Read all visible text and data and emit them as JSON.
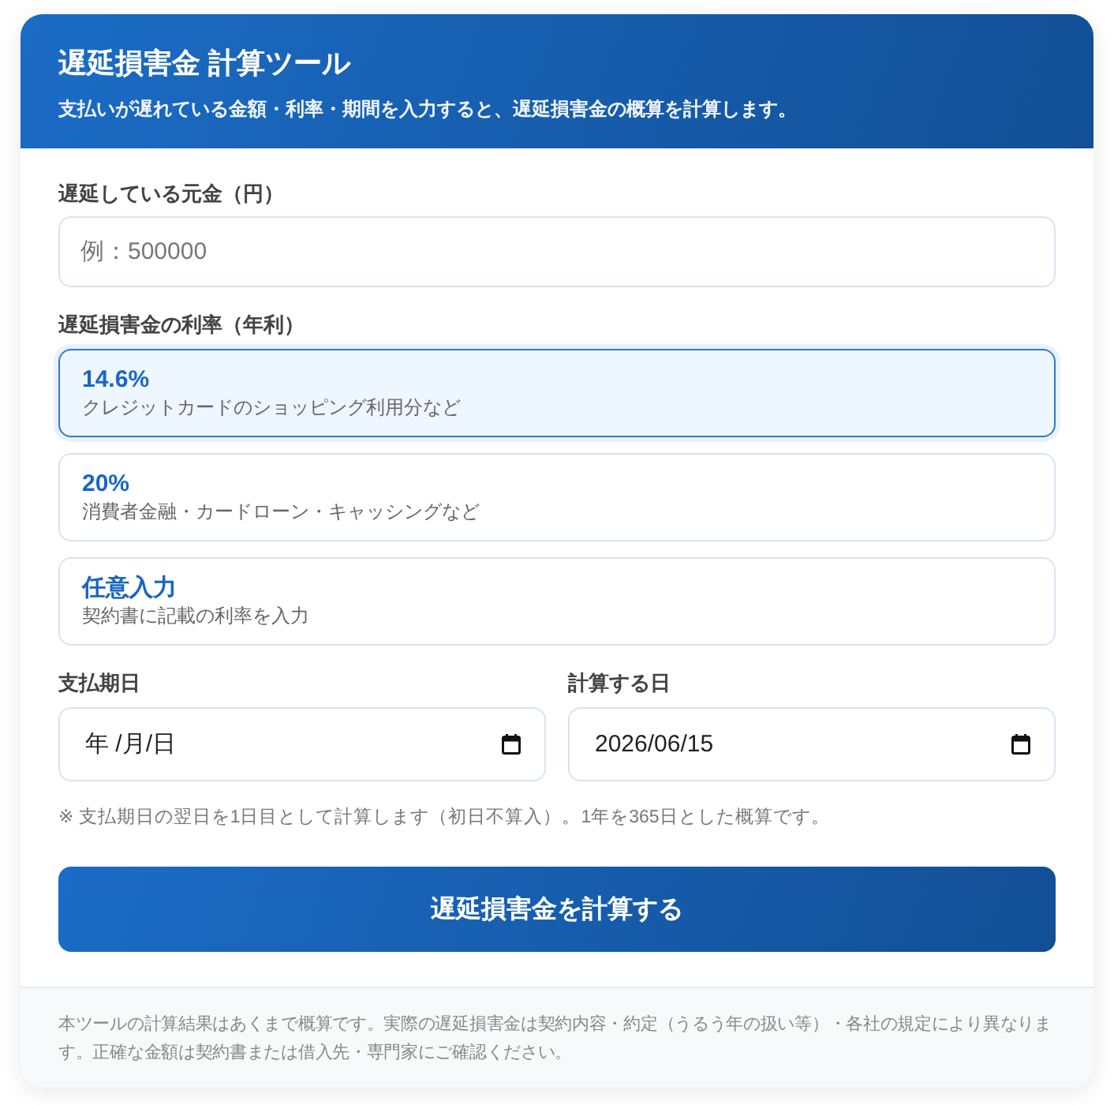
{
  "header": {
    "title": "遅延損害金 計算ツール",
    "subtitle": "支払いが遅れている金額・利率・期間を入力すると、遅延損害金の概算を計算します。"
  },
  "principal": {
    "label": "遅延している元金（円）",
    "placeholder": "例：500000"
  },
  "rate": {
    "label": "遅延損害金の利率（年利）",
    "options": [
      {
        "value": "14.6%",
        "description": "クレジットカードのショッピング利用分など",
        "selected": true
      },
      {
        "value": "20%",
        "description": "消費者金融・カードローン・キャッシングなど",
        "selected": false
      },
      {
        "value": "任意入力",
        "description": "契約書に記載の利率を入力",
        "selected": false
      }
    ]
  },
  "dates": [
    {
      "label": "支払期日",
      "placeholder": "年 /月/日"
    },
    {
      "label": "計算する日",
      "value": "2026/06/15"
    }
  ],
  "note": "※ 支払期日の翌日を1日目として計算します（初日不算入）。1年を365日とした概算です。",
  "submit_button": "遅延損害金を計算する",
  "footer": "本ツールの計算結果はあくまで概算です。実際の遅延損害金は契約内容・約定（うるう年の扱い等）・各社の規定により異なります。正確な金額は契約書または借入先・専門家にご確認ください。"
}
